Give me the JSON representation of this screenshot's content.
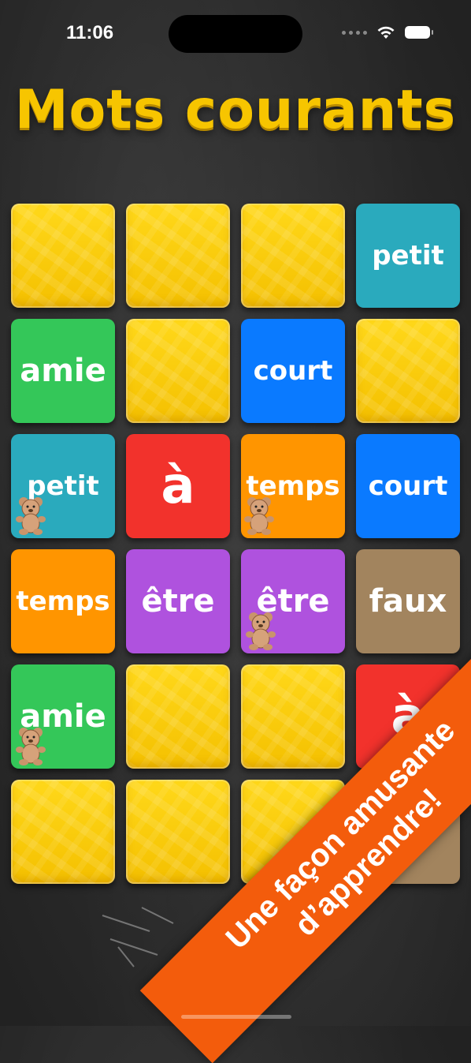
{
  "status_bar": {
    "time": "11:06"
  },
  "title": "Mots courants",
  "colors": {
    "title": "#f7c500",
    "banner": "#f35c0c",
    "card_back": "#f4c000"
  },
  "grid": {
    "rows": 6,
    "cols": 4,
    "cards": [
      {
        "row": 0,
        "col": 0,
        "state": "hidden"
      },
      {
        "row": 0,
        "col": 1,
        "state": "hidden"
      },
      {
        "row": 0,
        "col": 2,
        "state": "hidden"
      },
      {
        "row": 0,
        "col": 3,
        "state": "revealed",
        "word": "petit",
        "color": "#2aaabd"
      },
      {
        "row": 1,
        "col": 0,
        "state": "revealed",
        "word": "amie",
        "color": "#34c759"
      },
      {
        "row": 1,
        "col": 1,
        "state": "hidden"
      },
      {
        "row": 1,
        "col": 2,
        "state": "revealed",
        "word": "court",
        "color": "#0a7aff"
      },
      {
        "row": 1,
        "col": 3,
        "state": "hidden"
      },
      {
        "row": 2,
        "col": 0,
        "state": "revealed",
        "word": "petit",
        "color": "#2aaabd",
        "bear": true
      },
      {
        "row": 2,
        "col": 1,
        "state": "revealed",
        "word": "à",
        "color": "#f2322c"
      },
      {
        "row": 2,
        "col": 2,
        "state": "revealed",
        "word": "temps",
        "color": "#ff9500",
        "bear": true
      },
      {
        "row": 2,
        "col": 3,
        "state": "revealed",
        "word": "court",
        "color": "#0a7aff"
      },
      {
        "row": 3,
        "col": 0,
        "state": "revealed",
        "word": "temps",
        "color": "#ff9500"
      },
      {
        "row": 3,
        "col": 1,
        "state": "revealed",
        "word": "être",
        "color": "#af52de"
      },
      {
        "row": 3,
        "col": 2,
        "state": "revealed",
        "word": "être",
        "color": "#af52de",
        "bear": true
      },
      {
        "row": 3,
        "col": 3,
        "state": "revealed",
        "word": "faux",
        "color": "#a2845e"
      },
      {
        "row": 4,
        "col": 0,
        "state": "revealed",
        "word": "amie",
        "color": "#34c759",
        "bear": true
      },
      {
        "row": 4,
        "col": 1,
        "state": "hidden"
      },
      {
        "row": 4,
        "col": 2,
        "state": "hidden"
      },
      {
        "row": 4,
        "col": 3,
        "state": "revealed",
        "word": "à",
        "color": "#f2322c"
      },
      {
        "row": 5,
        "col": 0,
        "state": "hidden"
      },
      {
        "row": 5,
        "col": 1,
        "state": "hidden"
      },
      {
        "row": 5,
        "col": 2,
        "state": "hidden"
      },
      {
        "row": 5,
        "col": 3,
        "state": "revealed",
        "word": "",
        "color": "#a2845e"
      }
    ]
  },
  "banner": {
    "line1": "Une façon amusante",
    "line2": "d’apprendre!"
  }
}
